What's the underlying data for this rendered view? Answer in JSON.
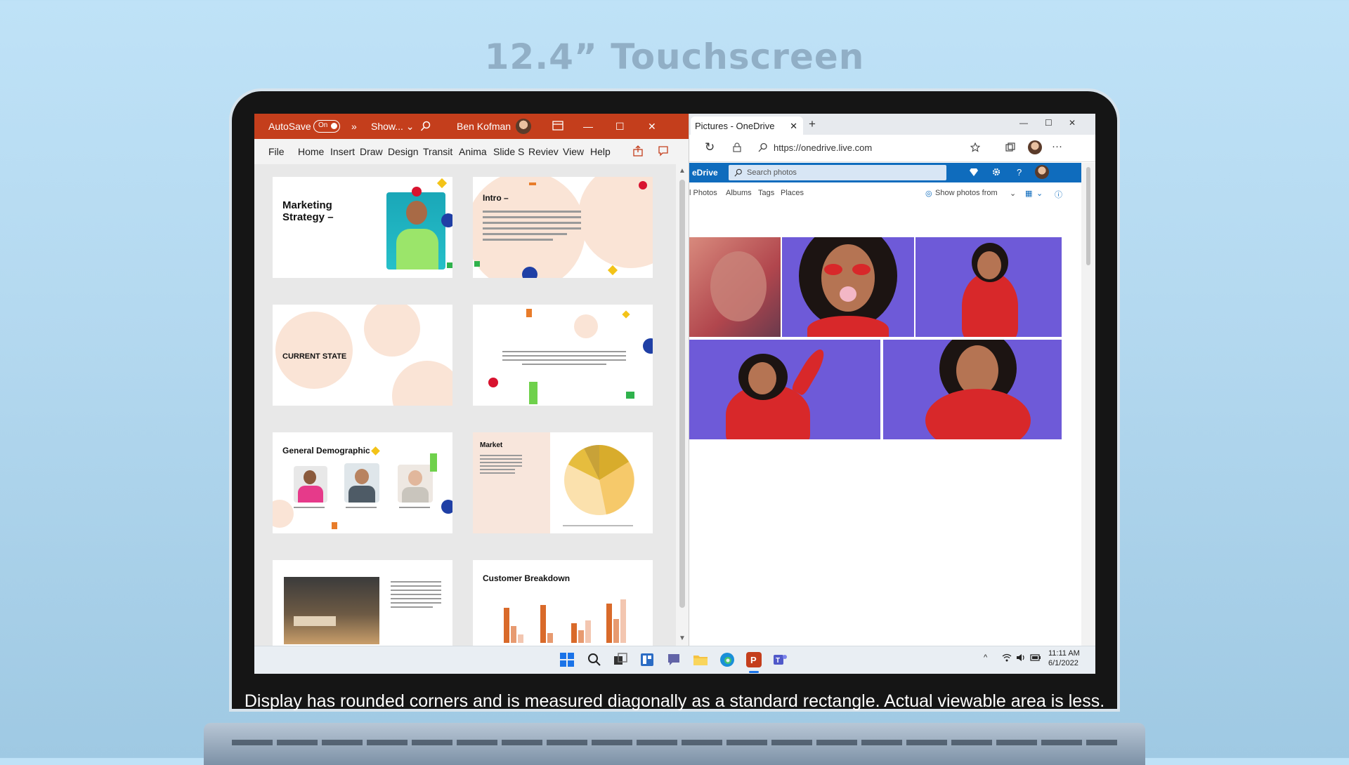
{
  "headline": "12.4” Touchscreen",
  "caption": "Display has rounded corners and is measured diagonally as a standard rectangle. Actual viewable area is less.",
  "powerpoint": {
    "autosave_label": "AutoSave",
    "autosave_state": "On",
    "more_glyph": "»",
    "file_name": "Show... ⌄",
    "user_name": "Ben Kofman",
    "window_controls": {
      "minimize": "—",
      "maximize": "☐",
      "close": "✕"
    },
    "menu": [
      "File",
      "Home",
      "Insert",
      "Draw",
      "Design",
      "Transit",
      "Anima",
      "Slide S",
      "Reviev",
      "View",
      "Help"
    ],
    "share_icon": "share-icon",
    "comments_icon": "comment-icon",
    "accent_color": "#c43e1c",
    "slides": [
      {
        "title": "Marketing\nStrategy –"
      },
      {
        "title": "Intro –"
      },
      {
        "title": "CURRENT STATE"
      },
      {
        "title": ""
      },
      {
        "title": "General Demographic"
      },
      {
        "title": "Market"
      },
      {
        "title": ""
      },
      {
        "title": "Customer Breakdown"
      }
    ],
    "slide_text": {
      "intro": "By the digital girl you accordingly digital and environmental. focus n and marketing accompanying modern marketing strategies",
      "quote": "“Marketing strategies and effective usage sales to obtain new and maintain current customers. Targeting specific populations is typical in marketing with the targeting depends on the type of merchandise or service.”"
    }
  },
  "edge": {
    "tab_title": "Pictures - OneDrive",
    "tab_close": "✕",
    "new_tab": "+",
    "window_controls": {
      "minimize": "—",
      "maximize": "☐",
      "close": "✕"
    },
    "url": "https://onedrive.live.com",
    "refresh_glyph": "↻",
    "more_glyph": "···",
    "onedrive": {
      "brand": "eDrive",
      "search_placeholder": "Search photos",
      "nav": [
        "l Photos",
        "Albums",
        "Tags",
        "Places"
      ],
      "filter_label": "Show photos from",
      "brand_color": "#0f6cbd"
    }
  },
  "taskbar": {
    "time": "11:11 AM",
    "date": "6/1/2022",
    "tray_chevron": "^"
  }
}
